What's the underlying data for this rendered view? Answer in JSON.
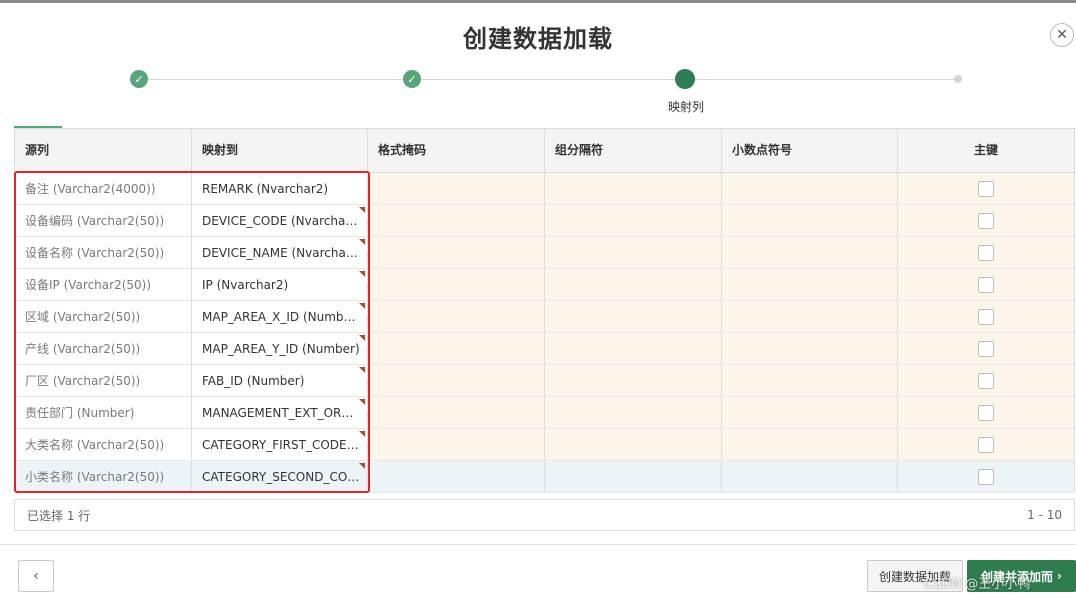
{
  "dialog": {
    "title": "创建数据加载",
    "close_icon": "close-icon"
  },
  "wizard": {
    "steps": [
      {
        "state": "done",
        "label": ""
      },
      {
        "state": "done",
        "label": ""
      },
      {
        "state": "current",
        "label": "映射列"
      },
      {
        "state": "future",
        "label": ""
      }
    ],
    "check_glyph": "✓"
  },
  "grid": {
    "columns": [
      "源列",
      "映射到",
      "格式掩码",
      "组分隔符",
      "小数点符号",
      "主键"
    ],
    "rows": [
      {
        "source": "备注 (Varchar2(4000))",
        "target": "REMARK (Nvarchar2)",
        "primary_key": false
      },
      {
        "source": "设备编码 (Varchar2(50))",
        "target": "DEVICE_CODE (Nvarchar2)",
        "primary_key": false
      },
      {
        "source": "设备名称 (Varchar2(50))",
        "target": "DEVICE_NAME (Nvarchar2)",
        "primary_key": false
      },
      {
        "source": "设备IP (Varchar2(50))",
        "target": "IP (Nvarchar2)",
        "primary_key": false
      },
      {
        "source": "区域 (Varchar2(50))",
        "target": "MAP_AREA_X_ID (Number)",
        "primary_key": false
      },
      {
        "source": "产线 (Varchar2(50))",
        "target": "MAP_AREA_Y_ID (Number)",
        "primary_key": false
      },
      {
        "source": "厂区 (Varchar2(50))",
        "target": "FAB_ID (Number)",
        "primary_key": false
      },
      {
        "source": "责任部门 (Number)",
        "target": "MANAGEMENT_EXT_ORG...",
        "primary_key": false
      },
      {
        "source": "大类名称 (Varchar2(50))",
        "target": "CATEGORY_FIRST_CODE (...",
        "primary_key": false
      },
      {
        "source": "小类名称 (Varchar2(50))",
        "target": "CATEGORY_SECOND_COD...",
        "primary_key": false
      }
    ],
    "selected_row_index": 9
  },
  "footer": {
    "selection_text": "已选择 1 行",
    "pagination": "1 - 10"
  },
  "buttons": {
    "back_glyph": "‹",
    "create_load": "创建数据加载",
    "create_and_add": "创建并添加而"
  },
  "watermark": "CSDN @王小小鸭",
  "colors": {
    "accent_green": "#2f7d4e",
    "highlight_red": "#e0262b",
    "editable_cell": "#fcf5ea",
    "selected_row": "#edf4f8"
  }
}
